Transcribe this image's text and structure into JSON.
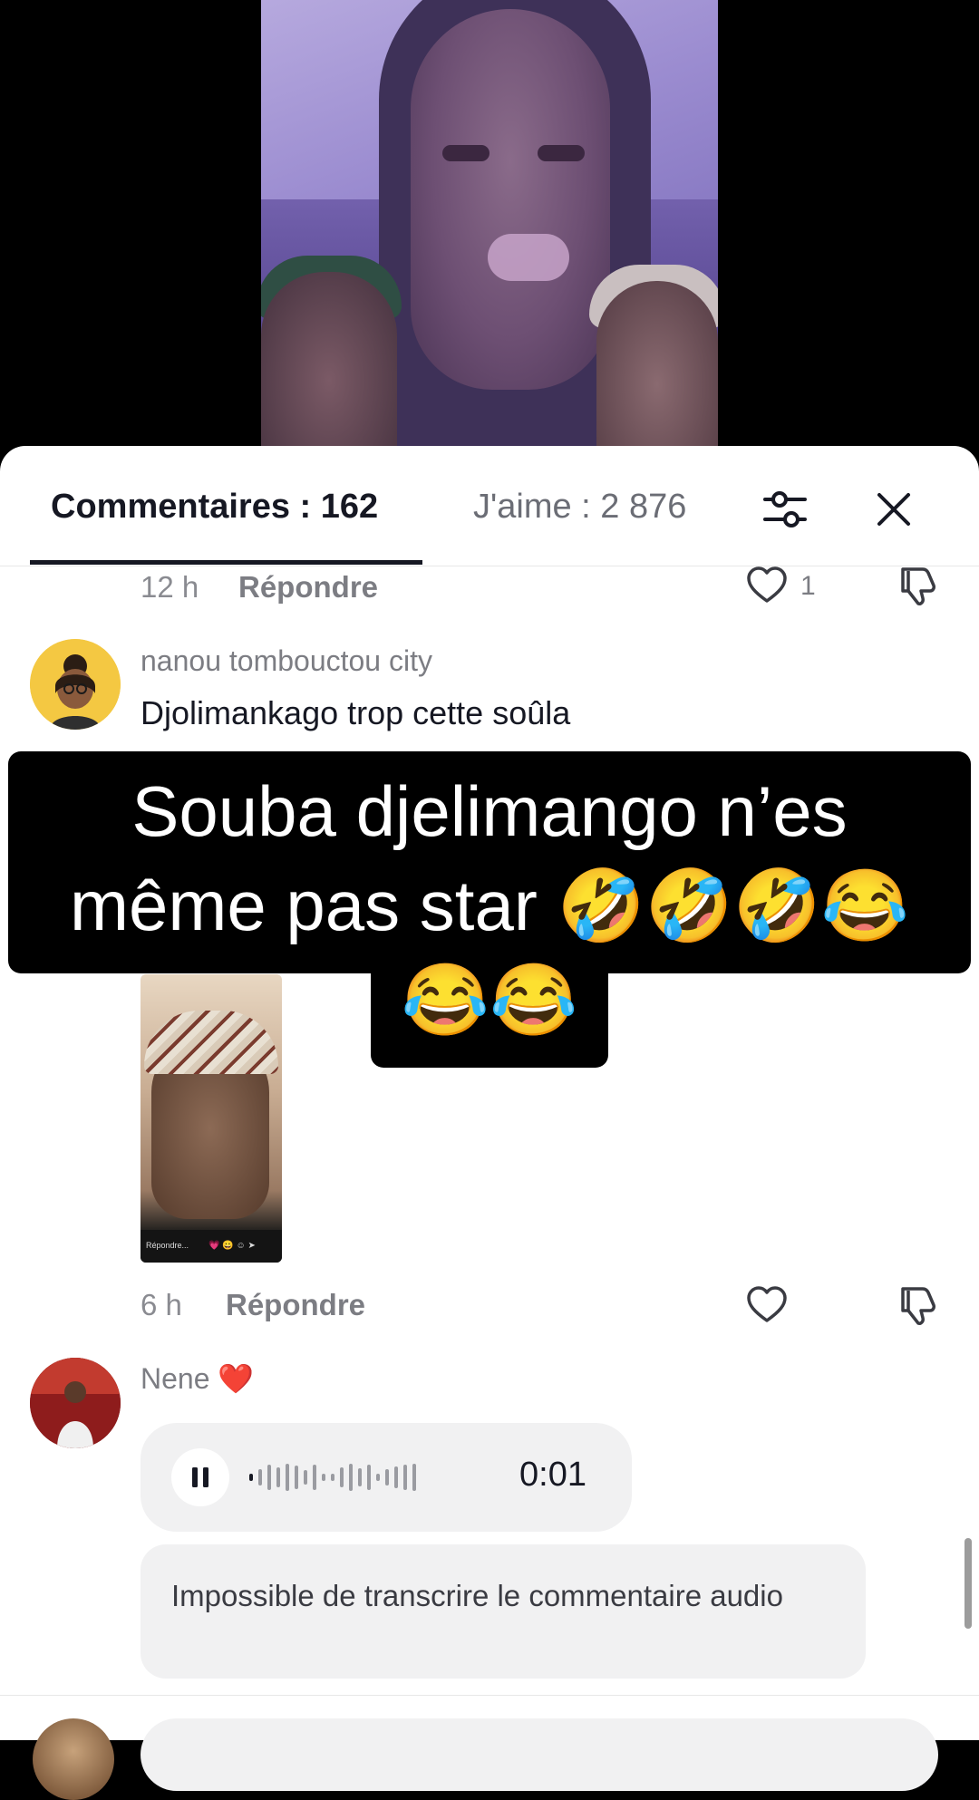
{
  "tabs": {
    "comments_label": "Commentaires : 162",
    "likes_label": "J'aime : 2 876"
  },
  "icons": {
    "filter": "sliders-icon",
    "close": "close-icon",
    "like": "heart-outline-icon",
    "dislike": "thumbs-down-icon",
    "pause": "pause-icon"
  },
  "comments": [
    {
      "time": "12 h",
      "reply_label": "Répondre",
      "like_count": "1"
    },
    {
      "username": "nanou tombouctou city",
      "text": "Djolimankago trop cette soûla",
      "time": "6 h",
      "reply_label": "Répondre"
    },
    {
      "username": "Nene ❤️",
      "audio_duration": "0:01",
      "transcript": "Impossible de transcrire le commentaire audio"
    }
  ],
  "caption": {
    "line1": "Souba djelimango n’es",
    "line2": "même pas star 🤣🤣🤣😂",
    "line3": "😂😂"
  },
  "thumb_bar": {
    "reply_label": "Répondre...",
    "icons": "💗 😀 ☺ ➤"
  }
}
